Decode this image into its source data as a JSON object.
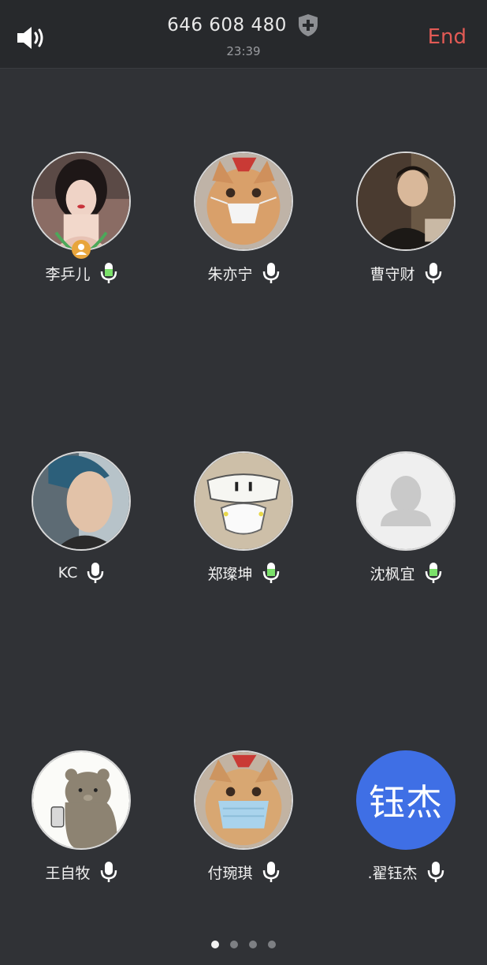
{
  "header": {
    "call_id": "646 608 480",
    "timer": "23:39",
    "end_label": "End",
    "speaker_icon": "speaker-icon",
    "shield_icon": "shield-plus-icon",
    "end_color": "#e25a55"
  },
  "participants": [
    {
      "name": "李乒儿",
      "avatar_type": "photo",
      "mic": "active",
      "is_host": true
    },
    {
      "name": "朱亦宁",
      "avatar_type": "photo",
      "mic": "muted",
      "is_host": false
    },
    {
      "name": "曹守财",
      "avatar_type": "photo",
      "mic": "muted",
      "is_host": false
    },
    {
      "name": "KC",
      "avatar_type": "photo",
      "mic": "muted",
      "is_host": false
    },
    {
      "name": "郑璨坤",
      "avatar_type": "photo",
      "mic": "active",
      "is_host": false
    },
    {
      "name": "沈枫宜",
      "avatar_type": "placeholder",
      "mic": "active",
      "is_host": false
    },
    {
      "name": "王自牧",
      "avatar_type": "photo",
      "mic": "muted",
      "is_host": false
    },
    {
      "name": "付琬琪",
      "avatar_type": "photo",
      "mic": "muted",
      "is_host": false
    },
    {
      "name": ".翟钰杰",
      "avatar_type": "initials",
      "initials": "钰杰",
      "mic": "muted",
      "is_host": false,
      "avatar_color": "#3f6fe5"
    }
  ],
  "pagination": {
    "pages": 4,
    "current": 1
  },
  "colors": {
    "background": "#303236",
    "header": "#27292c",
    "mic_active": "#7be06a",
    "mic_idle": "#ffffff"
  }
}
